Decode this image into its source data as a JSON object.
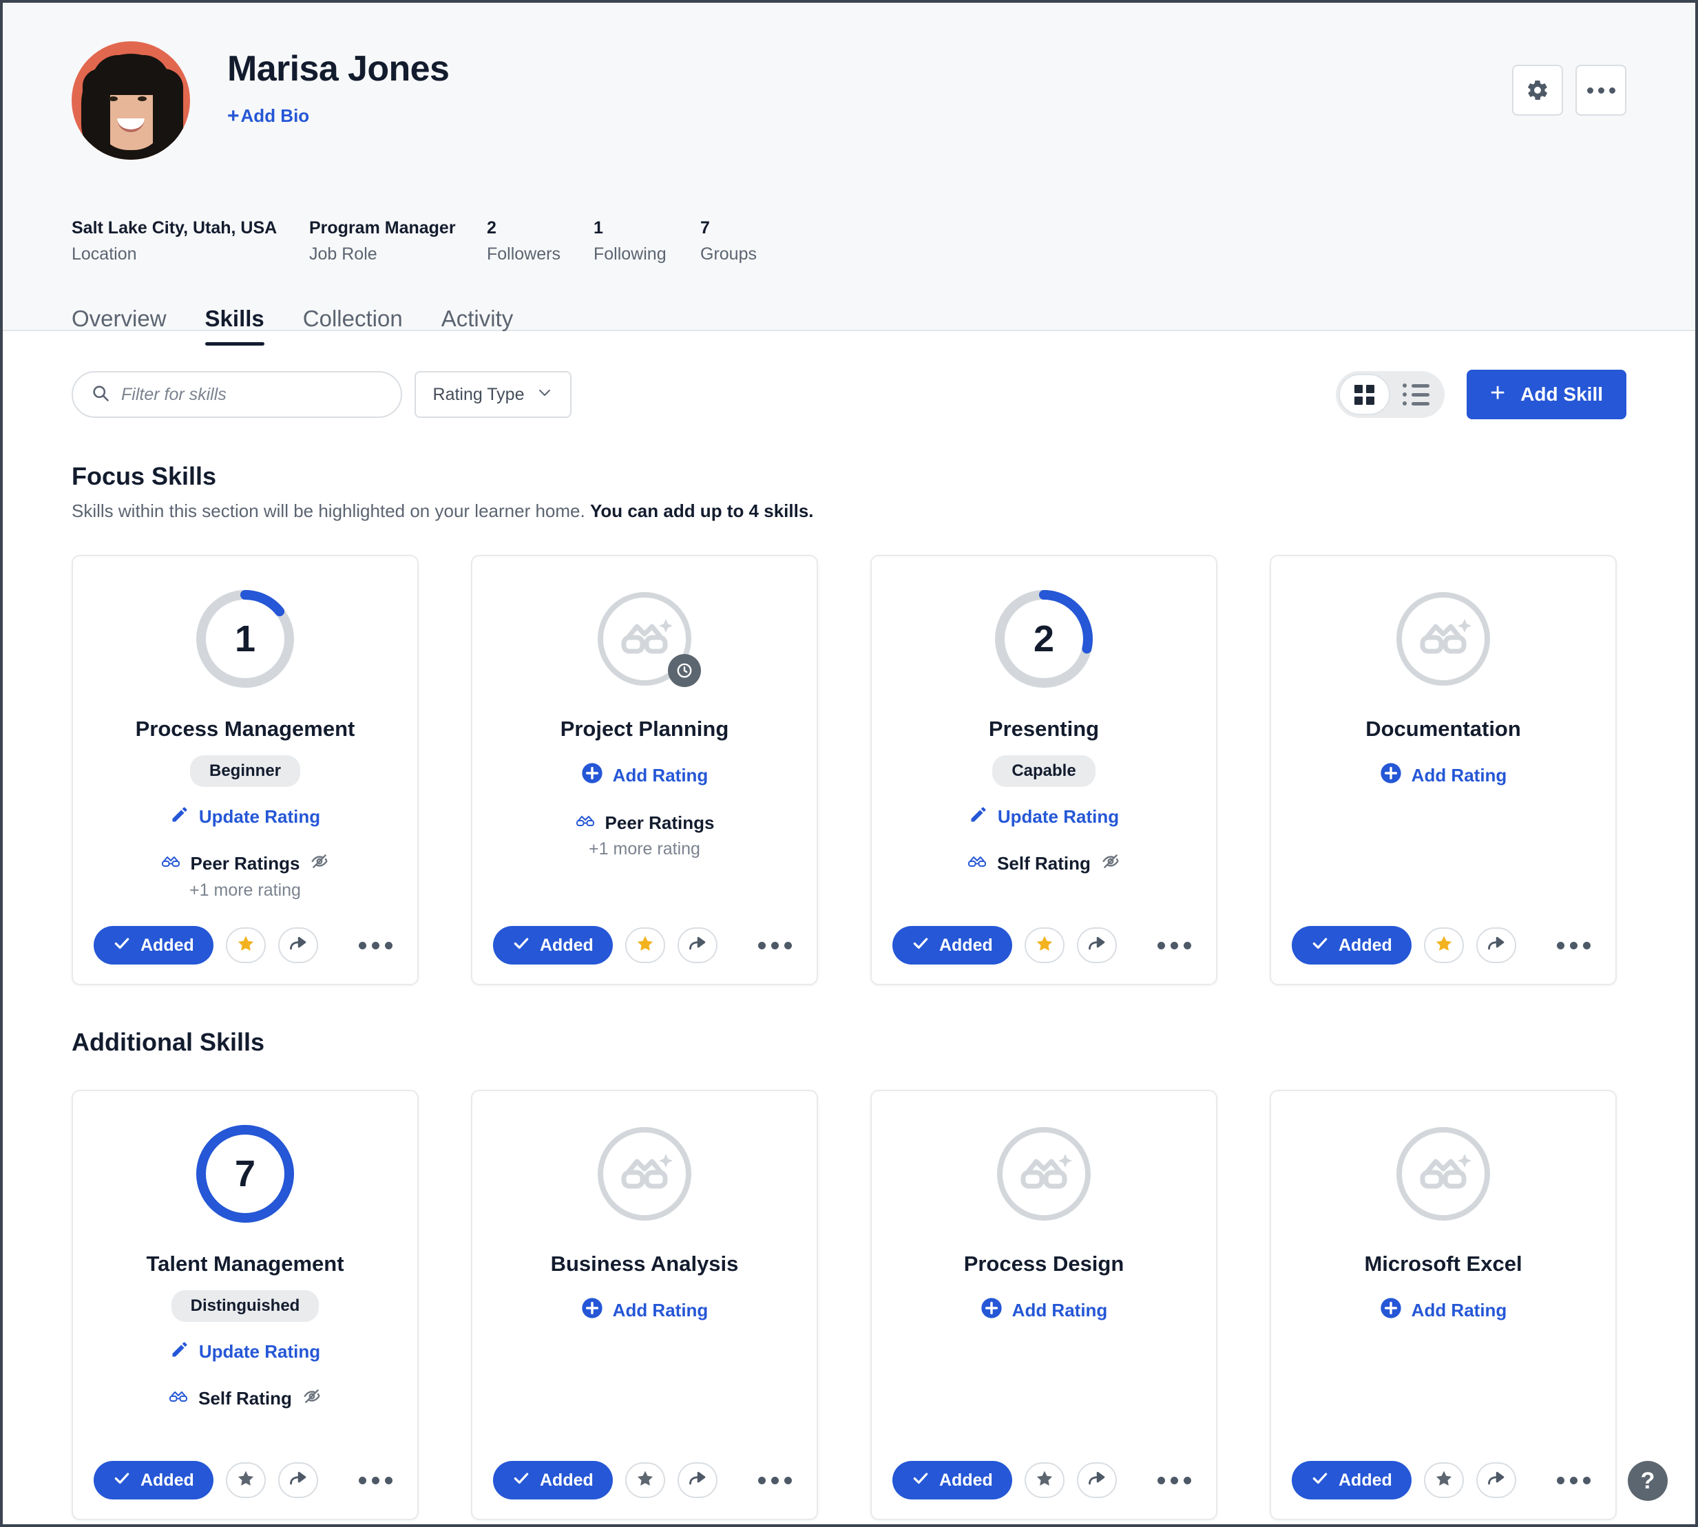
{
  "profile": {
    "name": "Marisa Jones",
    "add_bio_label": "Add Bio",
    "add_bio_plus": "+",
    "avatar_alt": "avatar",
    "settings_icon": "gear-icon",
    "more_icon": "ellipsis-icon",
    "meta": [
      {
        "value": "Salt Lake City, Utah, USA",
        "label": "Location"
      },
      {
        "value": "Program Manager",
        "label": "Job Role"
      },
      {
        "value": "2",
        "label": "Followers"
      },
      {
        "value": "1",
        "label": "Following"
      },
      {
        "value": "7",
        "label": "Groups"
      }
    ],
    "tabs": [
      {
        "label": "Overview",
        "active": false
      },
      {
        "label": "Skills",
        "active": true
      },
      {
        "label": "Collection",
        "active": false
      },
      {
        "label": "Activity",
        "active": false
      }
    ]
  },
  "toolbar": {
    "search_placeholder": "Filter for skills",
    "search_value": "",
    "search_icon": "search-icon",
    "rating_type_label": "Rating Type",
    "chevron_icon": "chevron-down-icon",
    "grid_view_icon": "grid-view-icon",
    "list_view_icon": "list-view-icon",
    "active_view": "grid",
    "add_skill_label": "Add Skill",
    "add_skill_plus": "+"
  },
  "sections": [
    {
      "title": "Focus Skills",
      "subtitle_normal": "Skills within this section will be highlighted on your learner home. ",
      "subtitle_bold": "You can add up to 4 skills.",
      "cards": [
        {
          "name": "Process Management",
          "rating_value": "1",
          "rating_max": 7,
          "level": "Beginner",
          "action_label": "Update Rating",
          "action_icon": "pencil-icon",
          "rating_source": "Peer Ratings",
          "rating_source_icon": "glasses-icon",
          "hidden_icon": "eye-slash-icon",
          "more_rating": "+1 more rating",
          "added_label": "Added",
          "check_icon": "check-icon",
          "star_icon": "star-icon",
          "star_filled": true,
          "share_icon": "share-icon",
          "more_icon": "ellipsis-icon",
          "badge": ""
        },
        {
          "name": "Project Planning",
          "rating_value": "",
          "rating_max": 7,
          "level": "",
          "action_label": "Add Rating",
          "action_icon": "plus-circle-icon",
          "rating_source": "Peer Ratings",
          "rating_source_icon": "glasses-icon",
          "hidden_icon": "",
          "more_rating": "+1 more rating",
          "added_label": "Added",
          "check_icon": "check-icon",
          "star_icon": "star-icon",
          "star_filled": true,
          "share_icon": "share-icon",
          "more_icon": "ellipsis-icon",
          "badge": "clock-icon"
        },
        {
          "name": "Presenting",
          "rating_value": "2",
          "rating_max": 7,
          "level": "Capable",
          "action_label": "Update Rating",
          "action_icon": "pencil-icon",
          "rating_source": "Self Rating",
          "rating_source_icon": "glasses-icon",
          "hidden_icon": "eye-slash-icon",
          "more_rating": "",
          "added_label": "Added",
          "check_icon": "check-icon",
          "star_icon": "star-icon",
          "star_filled": true,
          "share_icon": "share-icon",
          "more_icon": "ellipsis-icon",
          "badge": ""
        },
        {
          "name": "Documentation",
          "rating_value": "",
          "rating_max": 7,
          "level": "",
          "action_label": "Add Rating",
          "action_icon": "plus-circle-icon",
          "rating_source": "",
          "rating_source_icon": "",
          "hidden_icon": "",
          "more_rating": "",
          "added_label": "Added",
          "check_icon": "check-icon",
          "star_icon": "star-icon",
          "star_filled": true,
          "share_icon": "share-icon",
          "more_icon": "ellipsis-icon",
          "badge": ""
        }
      ]
    },
    {
      "title": "Additional Skills",
      "subtitle_normal": "",
      "subtitle_bold": "",
      "cards": [
        {
          "name": "Talent Management",
          "rating_value": "7",
          "rating_max": 7,
          "level": "Distinguished",
          "action_label": "Update Rating",
          "action_icon": "pencil-icon",
          "rating_source": "Self Rating",
          "rating_source_icon": "glasses-icon",
          "hidden_icon": "eye-slash-icon",
          "more_rating": "",
          "added_label": "Added",
          "check_icon": "check-icon",
          "star_icon": "star-icon",
          "star_filled": false,
          "share_icon": "share-icon",
          "more_icon": "ellipsis-icon",
          "badge": ""
        },
        {
          "name": "Business Analysis",
          "rating_value": "",
          "rating_max": 7,
          "level": "",
          "action_label": "Add Rating",
          "action_icon": "plus-circle-icon",
          "rating_source": "",
          "rating_source_icon": "",
          "hidden_icon": "",
          "more_rating": "",
          "added_label": "Added",
          "check_icon": "check-icon",
          "star_icon": "star-icon",
          "star_filled": false,
          "share_icon": "share-icon",
          "more_icon": "ellipsis-icon",
          "badge": ""
        },
        {
          "name": "Process Design",
          "rating_value": "",
          "rating_max": 7,
          "level": "",
          "action_label": "Add Rating",
          "action_icon": "plus-circle-icon",
          "rating_source": "",
          "rating_source_icon": "",
          "hidden_icon": "",
          "more_rating": "",
          "added_label": "Added",
          "check_icon": "check-icon",
          "star_icon": "star-icon",
          "star_filled": false,
          "share_icon": "share-icon",
          "more_icon": "ellipsis-icon",
          "badge": ""
        },
        {
          "name": "Microsoft Excel",
          "rating_value": "",
          "rating_max": 7,
          "level": "",
          "action_label": "Add Rating",
          "action_icon": "plus-circle-icon",
          "rating_source": "",
          "rating_source_icon": "",
          "hidden_icon": "",
          "more_rating": "",
          "added_label": "Added",
          "check_icon": "check-icon",
          "star_icon": "star-icon",
          "star_filled": false,
          "share_icon": "share-icon",
          "more_icon": "ellipsis-icon",
          "badge": ""
        }
      ]
    }
  ],
  "help": {
    "label": "?",
    "icon": "question-mark-icon"
  },
  "colors": {
    "accent_blue": "#2557d6",
    "ring_track": "#d3d7db",
    "text_dark": "#131c2e",
    "text_muted": "#5b6471",
    "star_gold": "#f2b21e",
    "badge_gray": "#5c6670"
  }
}
